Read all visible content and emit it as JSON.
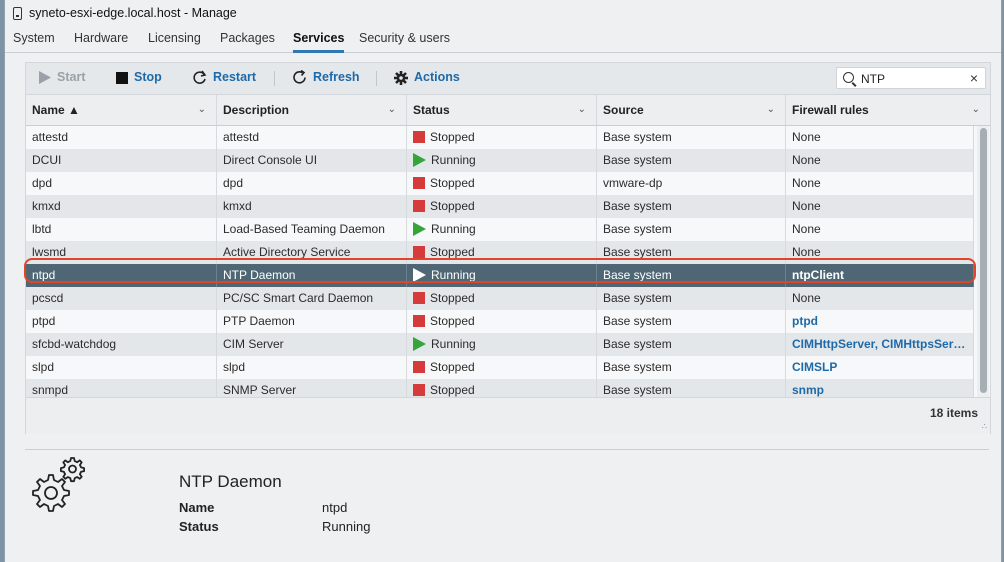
{
  "window": {
    "title": "syneto-esxi-edge.local.host - Manage"
  },
  "tabs": [
    "System",
    "Hardware",
    "Licensing",
    "Packages",
    "Services",
    "Security & users"
  ],
  "active_tab": "Services",
  "toolbar": {
    "start_label": "Start",
    "stop_label": "Stop",
    "restart_label": "Restart",
    "refresh_label": "Refresh",
    "actions_label": "Actions"
  },
  "search": {
    "value": "NTP",
    "clear": "×"
  },
  "table": {
    "columns": [
      "Name ▲",
      "Description",
      "Status",
      "Source",
      "Firewall rules"
    ],
    "rows": [
      {
        "name": "attestd",
        "description": "attestd",
        "status": "Stopped",
        "source": "Base system",
        "firewall": "None"
      },
      {
        "name": "DCUI",
        "description": "Direct Console UI",
        "status": "Running",
        "source": "Base system",
        "firewall": "None"
      },
      {
        "name": "dpd",
        "description": "dpd",
        "status": "Stopped",
        "source": "vmware-dp",
        "firewall": "None"
      },
      {
        "name": "kmxd",
        "description": "kmxd",
        "status": "Stopped",
        "source": "Base system",
        "firewall": "None"
      },
      {
        "name": "lbtd",
        "description": "Load-Based Teaming Daemon",
        "status": "Running",
        "source": "Base system",
        "firewall": "None"
      },
      {
        "name": "lwsmd",
        "description": "Active Directory Service",
        "status": "Stopped",
        "source": "Base system",
        "firewall": "None"
      },
      {
        "name": "ntpd",
        "description": "NTP Daemon",
        "status": "Running",
        "source": "Base system",
        "firewall": "ntpClient"
      },
      {
        "name": "pcscd",
        "description": "PC/SC Smart Card Daemon",
        "status": "Stopped",
        "source": "Base system",
        "firewall": "None"
      },
      {
        "name": "ptpd",
        "description": "PTP Daemon",
        "status": "Stopped",
        "source": "Base system",
        "firewall": "ptpd"
      },
      {
        "name": "sfcbd-watchdog",
        "description": "CIM Server",
        "status": "Running",
        "source": "Base system",
        "firewall": "CIMHttpServer, CIMHttpsSer…"
      },
      {
        "name": "slpd",
        "description": "slpd",
        "status": "Stopped",
        "source": "Base system",
        "firewall": "CIMSLP"
      },
      {
        "name": "snmpd",
        "description": "SNMP Server",
        "status": "Stopped",
        "source": "Base system",
        "firewall": "snmp"
      }
    ],
    "selected_row": "ntpd",
    "item_count": "18 items"
  },
  "details": {
    "title": "NTP Daemon",
    "name_label": "Name",
    "name_value": "ntpd",
    "status_label": "Status",
    "status_value": "Running"
  },
  "colors": {
    "accent": "#1e6aa8",
    "selected_row": "#4f6774",
    "stopped": "#d63b3b",
    "running": "#35a43a",
    "highlight": "#e0452b"
  }
}
